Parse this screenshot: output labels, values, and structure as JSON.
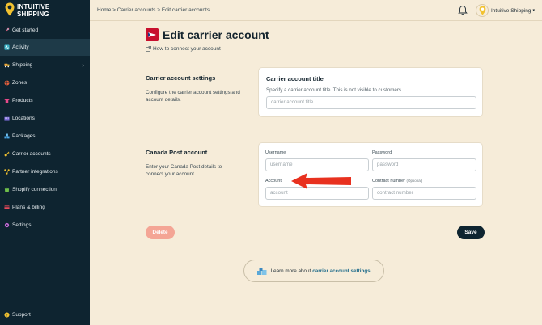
{
  "brand": {
    "line1": "INTUITIVE",
    "line2": "SHIPPING"
  },
  "sidebar": {
    "items": [
      {
        "label": "Get started"
      },
      {
        "label": "Activity"
      },
      {
        "label": "Shipping"
      },
      {
        "label": "Zones"
      },
      {
        "label": "Products"
      },
      {
        "label": "Locations"
      },
      {
        "label": "Packages"
      },
      {
        "label": "Carrier accounts"
      },
      {
        "label": "Partner integrations"
      },
      {
        "label": "Shopify connection"
      },
      {
        "label": "Plans & billing"
      },
      {
        "label": "Settings"
      }
    ],
    "support": "Support"
  },
  "topbar": {
    "breadcrumb": "Home > Carrier accounts > Edit carrier accounts",
    "account_name": "Intuitive Shipping"
  },
  "page": {
    "title": "Edit carrier account",
    "howto_link": "How to connect your account"
  },
  "settings_section": {
    "title": "Carrier account settings",
    "description": "Configure the carrier account settings and account details.",
    "card_title": "Carrier account title",
    "card_subtitle": "Specify a carrier account title. This is not visible to customers.",
    "title_placeholder": "carrier account title"
  },
  "canada_post_section": {
    "title": "Canada Post account",
    "description": "Enter your Canada Post details to connect your account.",
    "username_label": "Username",
    "username_placeholder": "username",
    "password_label": "Password",
    "password_placeholder": "password",
    "account_label": "Account",
    "account_placeholder": "account",
    "contract_label": "Contract number",
    "contract_optional": "(Optional)",
    "contract_placeholder": "contract number"
  },
  "actions": {
    "delete": "Delete",
    "save": "Save"
  },
  "learn_more": {
    "prefix": "Learn more about",
    "link": "carrier account settings",
    "suffix": "."
  },
  "colors": {
    "sidebar_bg": "#0e2430",
    "page_bg": "#f6ecd9",
    "accent_red": "#e8311f",
    "delete_btn": "#f4a595",
    "save_btn": "#0e2430",
    "link": "#1e6b8a"
  }
}
